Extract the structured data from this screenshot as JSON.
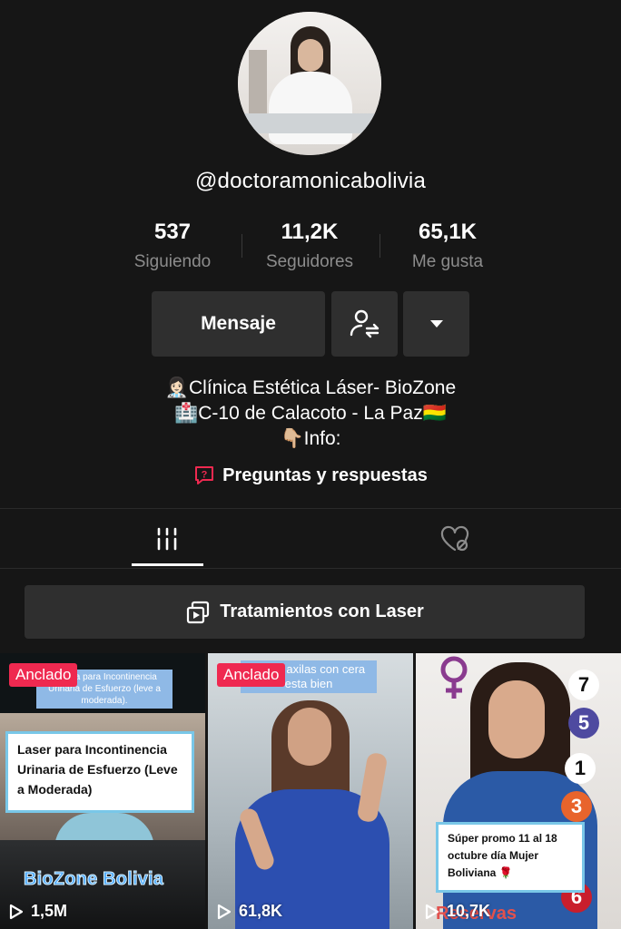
{
  "profile": {
    "username": "@doctoramonicabolivia",
    "stats": [
      {
        "value": "537",
        "label": "Siguiendo"
      },
      {
        "value": "11,2K",
        "label": "Seguidores"
      },
      {
        "value": "65,1K",
        "label": "Me gusta"
      }
    ]
  },
  "actions": {
    "message_label": "Mensaje",
    "follow_icon": "person-swap-icon",
    "more_icon": "caret-down-icon"
  },
  "bio": {
    "lines": [
      {
        "emoji": "👩🏻‍⚕️",
        "text": "Clínica Estética Láser- BioZone"
      },
      {
        "emoji": "🏥",
        "text": "C-10 de Calacoto - La Paz🇧🇴"
      },
      {
        "emoji": "👇🏼",
        "text": "Info:"
      }
    ]
  },
  "qa": {
    "label": "Preguntas y respuestas",
    "icon": "question-bubble-icon"
  },
  "tabs": [
    {
      "icon": "grid-icon",
      "active": true
    },
    {
      "icon": "liked-hidden-icon",
      "active": false
    }
  ],
  "playlist": {
    "label": "Tratamientos con Laser",
    "icon": "playlist-icon"
  },
  "videos": [
    {
      "pinned_label": "Anclado",
      "views": "1,5M",
      "overlay_small": "Fotona para Incontinencia Urinaria de Esfuerzo (leve a moderada).",
      "overlay_card": "Laser para Incontinencia Urinaria de Esfuerzo (Leve a Moderada)",
      "brand": "BioZone Bolivia"
    },
    {
      "pinned_label": "Anclado",
      "views": "61,8K",
      "overlay_small": "se las axilas con cera esta bien"
    },
    {
      "views": "10,7K",
      "overlay_card": "Súper promo 11 al 18 octubre día Mujer Boliviana 🌹",
      "bottom_text": "Reservas",
      "badges": [
        "7",
        "5",
        "1",
        "3",
        "6"
      ]
    }
  ],
  "colors": {
    "background": "#161616",
    "button": "#2f2f2f",
    "muted_text": "#8c8c8c",
    "pin_badge": "#ef2950",
    "qa_icon": "#ef2950"
  }
}
